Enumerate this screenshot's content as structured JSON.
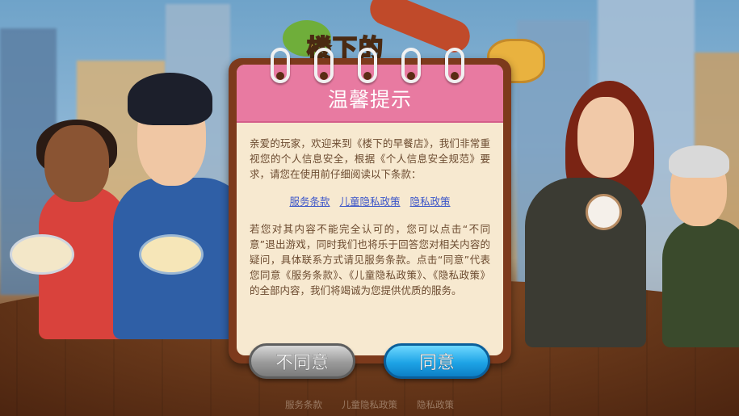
{
  "background": {
    "logo_text": "楼下的"
  },
  "dialog": {
    "title": "温馨提示",
    "paragraph1": "亲爱的玩家，欢迎来到《楼下的早餐店》，我们非常重视您的个人信息安全，根据《个人信息安全规范》要求，请您在使用前仔细阅读以下条款：",
    "links": [
      "服务条款",
      "儿童隐私政策",
      "隐私政策"
    ],
    "paragraph2": "若您对其内容不能完全认可的，您可以点击“不同意”退出游戏，同时我们也将乐于回答您对相关内容的疑问，具体联系方式请见服务条款。点击“同意”代表您同意《服务条款》、《儿童隐私政策》、《隐私政策》的全部内容，我们将竭诚为您提供优质的服务。",
    "disagree_label": "不同意",
    "agree_label": "同意"
  },
  "footer": {
    "links": [
      "服务条款",
      "儿童隐私政策",
      "隐私政策"
    ]
  },
  "colors": {
    "header_pink": "#e87aa1",
    "agree_blue": "#1ea4e6",
    "disagree_gray": "#9a9a9a",
    "link_blue": "#3b55c9"
  }
}
